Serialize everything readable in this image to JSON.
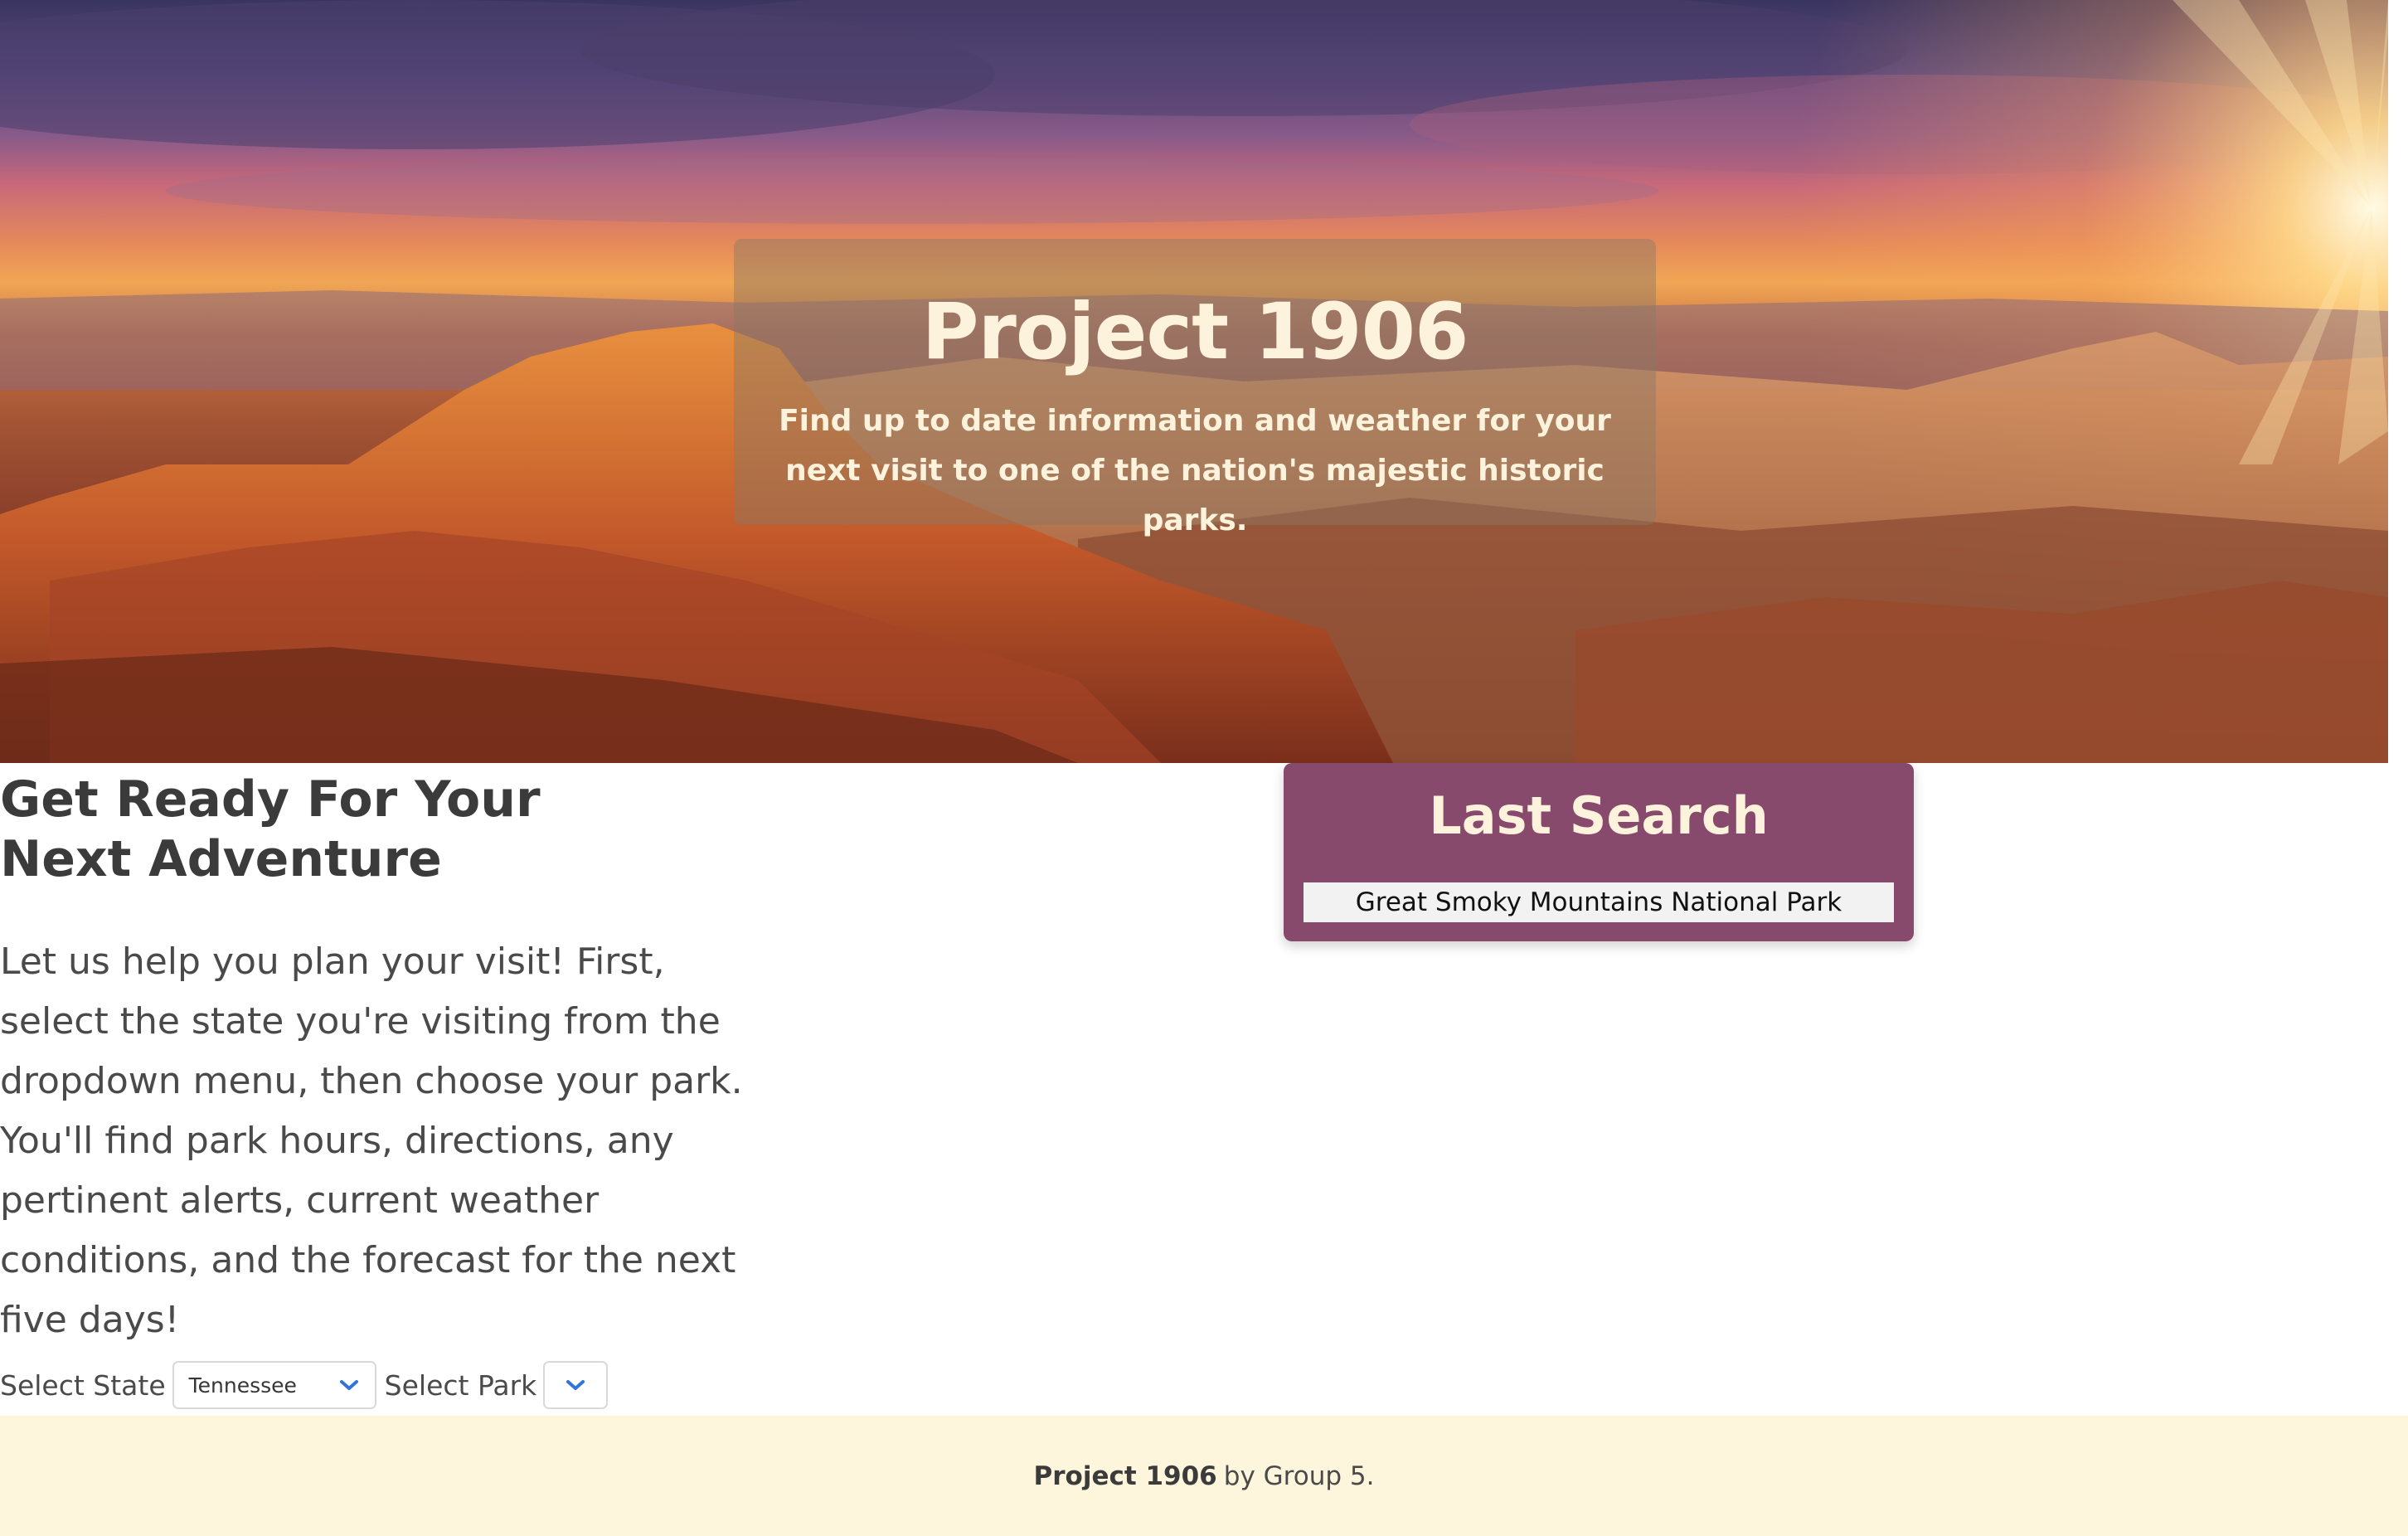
{
  "hero": {
    "title": "Project 1906",
    "subtitle": "Find up to date information and weather for your next visit to one of the nation's majestic historic parks."
  },
  "intro": {
    "heading": "Get Ready For Your Next Adventure",
    "text": "Let us help you plan your visit! First, select the state you're visiting from the dropdown menu, then choose your park. You'll find park hours, directions, any pertinent alerts, current weather conditions, and the forecast for the next five days!"
  },
  "selectors": {
    "state_label": "Select State",
    "state_value": "Tennessee",
    "park_label": "Select Park",
    "park_value": ""
  },
  "last_search": {
    "title": "Last Search",
    "items": [
      "Great Smoky Mountains National Park"
    ]
  },
  "footer": {
    "brand": "Project 1906",
    "text": "by Group 5."
  },
  "colors": {
    "card_bg": "#874a6c",
    "footer_bg": "#fdf5dc",
    "hero_text": "#fdf3dc",
    "chevron": "#3273dc"
  },
  "icons": [
    "chevron-down-icon"
  ]
}
